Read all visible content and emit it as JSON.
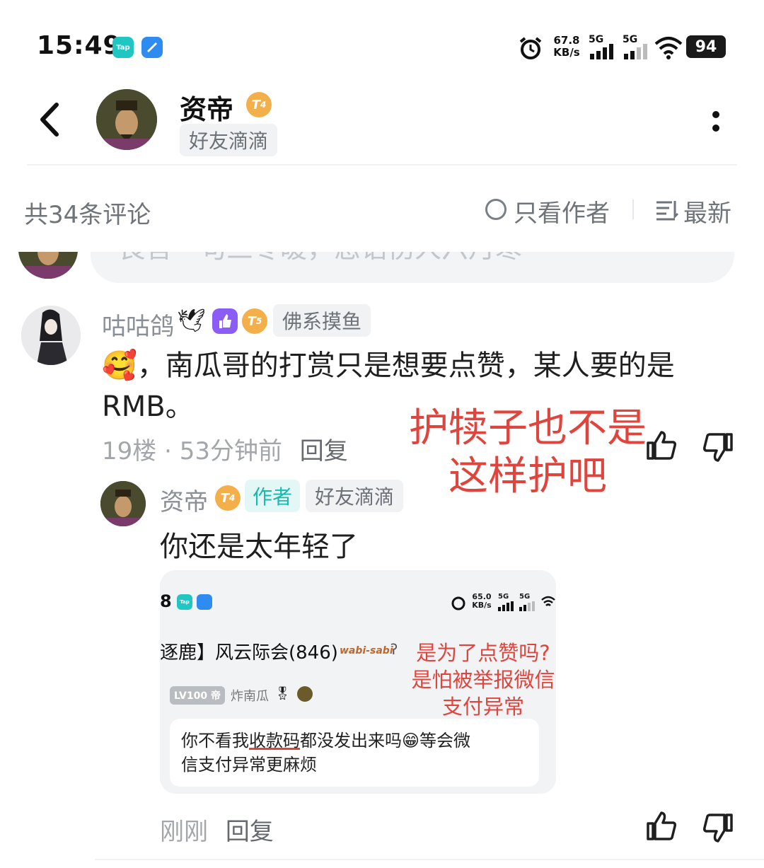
{
  "status_bar": {
    "time": "15:49",
    "app_icons": [
      {
        "name": "taptap-icon",
        "label": "Tap",
        "color": "#1fc6c2"
      },
      {
        "name": "browser-icon",
        "label": "",
        "color": "#2e8cf0"
      }
    ],
    "net_speed_value": "67.8",
    "net_speed_unit": "KB/s",
    "sim1": "5G",
    "sim2": "5G",
    "battery": "94"
  },
  "header": {
    "back_icon": "chevron-left-icon",
    "user_name": "资帝",
    "level": "4",
    "tag": "好友滴滴",
    "more_icon": "more-vertical-icon"
  },
  "filter_bar": {
    "comment_count": "共34条评论",
    "author_only": "只看作者",
    "sort": "最新",
    "sort_icon": "sort-lines-icon"
  },
  "prev_comment": {
    "partial_text": "良言一句三冬暖，恶语伤人六月寒"
  },
  "comments": [
    {
      "user": "咕咕鸽",
      "level": "5",
      "tag": "佛系摸鱼",
      "emoji": "🥰",
      "text_line1": "，南瓜哥的打赏只是想要点赞，某人要的是",
      "text_line2": "RMB。",
      "floor": "19楼",
      "dot": "·",
      "time": "53分钟前",
      "reply": "回复",
      "overlay_line1": "护犊子也不是",
      "overlay_line2": "这样护吧"
    }
  ],
  "reply": {
    "user": "资帝",
    "level": "4",
    "author_tag": "作者",
    "tag": "好友滴滴",
    "text": "你还是太年轻了",
    "time": "刚刚",
    "reply": "回复"
  },
  "embedded": {
    "time": "8",
    "net_speed_value": "65.0",
    "net_speed_unit": "KB/s",
    "sim1": "5G",
    "sim2": "5G",
    "group_title": "逐鹿】风云际会(846)",
    "logo_text": "wabi-sabi",
    "level_badge": "LV100 帝",
    "username": "炸南瓜",
    "red_line1": "是为了点赞吗?",
    "red_line2": "是怕被举报微信",
    "red_line3": "支付异常",
    "msg_part1": "你不看我",
    "msg_underlined": "收款码",
    "msg_part2": "都没发出来吗",
    "msg_emoji": "😁",
    "msg_part3": "等会微",
    "msg_line2": "信支付异常更麻烦"
  },
  "colors": {
    "accent_teal": "#17b8ad",
    "level_orange": "#f3b04a",
    "overlay_red": "#e0453d",
    "purple_badge": "#8b5cf6",
    "muted_text": "#6f747a"
  }
}
